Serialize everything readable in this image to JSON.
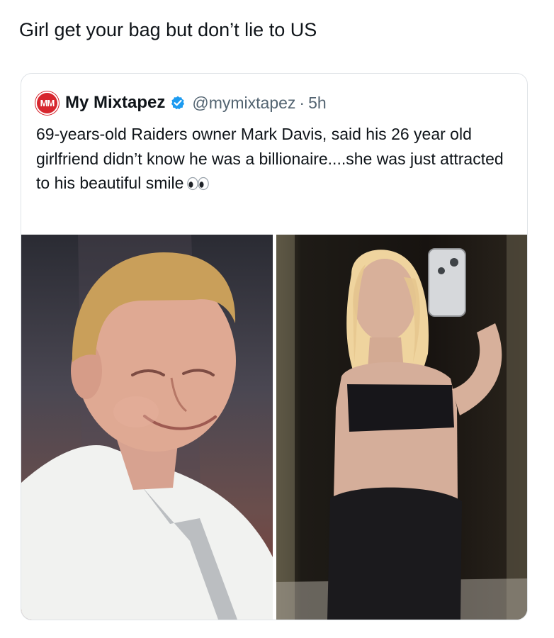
{
  "caption": "Girl get your bag but don’t lie to US",
  "quoted_post": {
    "avatar_initials": "MM",
    "display_name": "My Mixtapez",
    "verified_icon": "verified-badge-icon",
    "handle": "@mymixtapez",
    "separator": "·",
    "time": "5h",
    "text": "69-years-old Raiders owner Mark Davis, said his 26 year old girlfriend didn’t know he was a billionaire....she was just attracted to his beautiful smile",
    "trailing_icon": "eyes-emoji-icon",
    "media": [
      {
        "name": "older-man-photo"
      },
      {
        "name": "mirror-selfie-photo"
      }
    ]
  },
  "colors": {
    "text": "#0f1419",
    "secondary_text": "#536471",
    "verified": "#1d9bf0",
    "avatar": "#d7262e",
    "card_border": "#dfe3e7"
  }
}
